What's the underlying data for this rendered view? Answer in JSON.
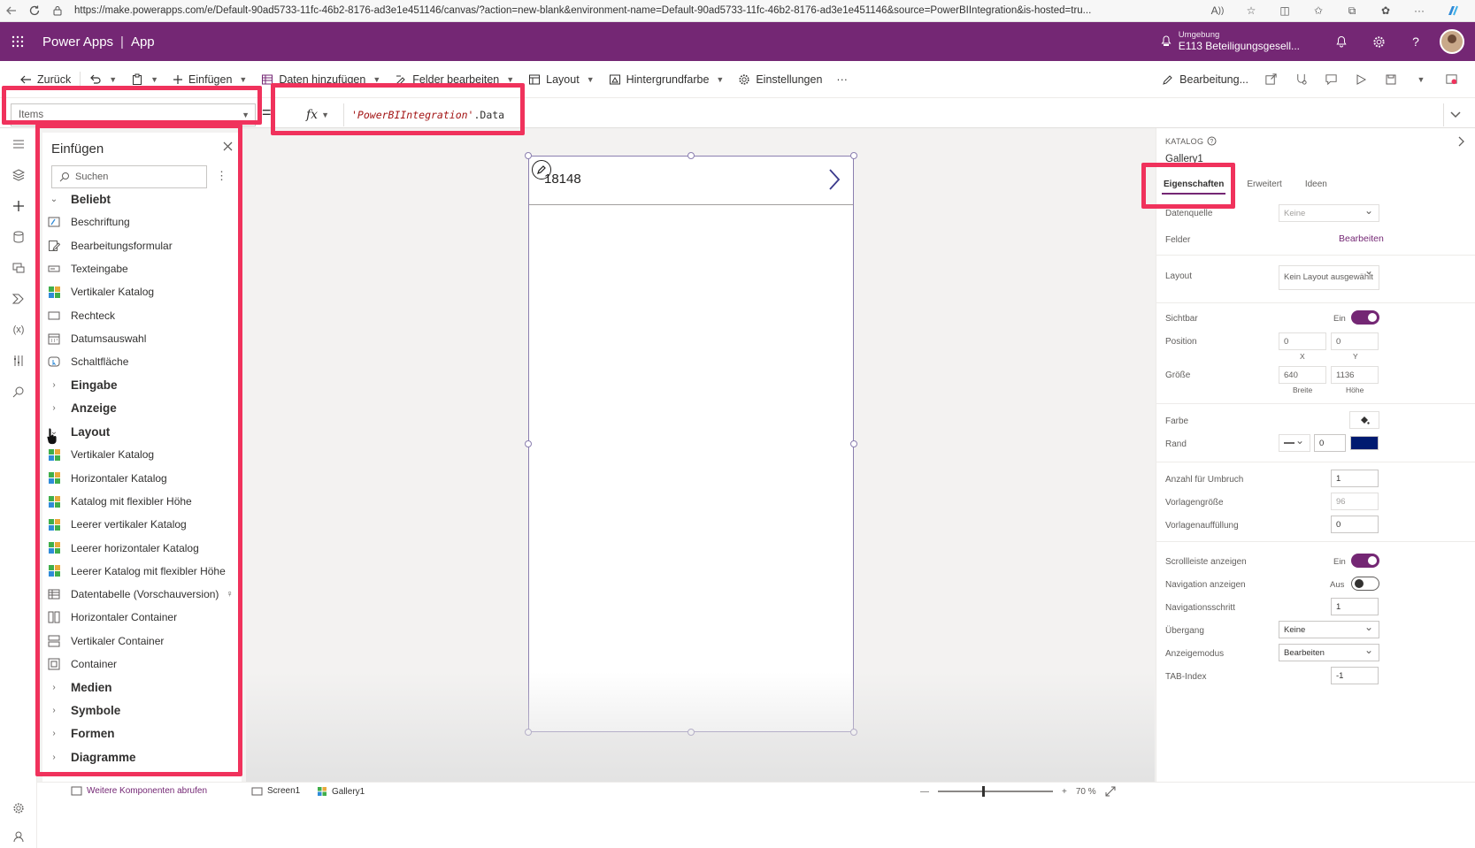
{
  "browser": {
    "url": "https://make.powerapps.com/e/Default-90ad5733-11fc-46b2-8176-ad3e1e451146/canvas/?action=new-blank&environment-name=Default-90ad5733-11fc-46b2-8176-ad3e1e451146&source=PowerBIIntegration&is-hosted=tru..."
  },
  "header": {
    "product": "Power Apps",
    "separator": "|",
    "app": "App",
    "env_label": "Umgebung",
    "env_name": "E113 Beteiligungsgesell..."
  },
  "commands": {
    "back": "Zurück",
    "insert": "Einfügen",
    "add_data": "Daten hinzufügen",
    "edit_fields": "Felder bearbeiten",
    "layout": "Layout",
    "background": "Hintergrundfarbe",
    "settings": "Einstellungen",
    "more": "···",
    "editing": "Bearbeitung..."
  },
  "formula": {
    "property": "Items",
    "equals": "=",
    "fx": "fx",
    "value_string": "'PowerBIIntegration'",
    "value_suffix": ".Data"
  },
  "insert_panel": {
    "title": "Einfügen",
    "search_placeholder": "Suchen",
    "items": [
      {
        "type": "category",
        "label": "Beliebt",
        "expanded": true
      },
      {
        "type": "item",
        "label": "Beschriftung",
        "icon": "label-icon"
      },
      {
        "type": "item",
        "label": "Bearbeitungsformular",
        "icon": "edit-form-icon"
      },
      {
        "type": "item",
        "label": "Texteingabe",
        "icon": "text-input-icon"
      },
      {
        "type": "item",
        "label": "Vertikaler Katalog",
        "icon": "gallery-icon"
      },
      {
        "type": "item",
        "label": "Rechteck",
        "icon": "rectangle-icon"
      },
      {
        "type": "item",
        "label": "Datumsauswahl",
        "icon": "calendar-icon"
      },
      {
        "type": "item",
        "label": "Schaltfläche",
        "icon": "button-icon"
      },
      {
        "type": "category",
        "label": "Eingabe",
        "expanded": false
      },
      {
        "type": "category",
        "label": "Anzeige",
        "expanded": false
      },
      {
        "type": "category",
        "label": "Layout",
        "expanded": true
      },
      {
        "type": "item",
        "label": "Vertikaler Katalog",
        "icon": "gallery-icon"
      },
      {
        "type": "item",
        "label": "Horizontaler Katalog",
        "icon": "gallery-icon"
      },
      {
        "type": "item",
        "label": "Katalog mit flexibler Höhe",
        "icon": "gallery-icon"
      },
      {
        "type": "item",
        "label": "Leerer vertikaler Katalog",
        "icon": "gallery-icon"
      },
      {
        "type": "item",
        "label": "Leerer horizontaler Katalog",
        "icon": "gallery-icon"
      },
      {
        "type": "item",
        "label": "Leerer Katalog mit flexibler Höhe",
        "icon": "gallery-icon"
      },
      {
        "type": "item",
        "label": "Datentabelle (Vorschauversion)",
        "icon": "table-icon",
        "extra": "lightbulb-icon"
      },
      {
        "type": "item",
        "label": "Horizontaler Container",
        "icon": "h-container-icon"
      },
      {
        "type": "item",
        "label": "Vertikaler Container",
        "icon": "v-container-icon"
      },
      {
        "type": "item",
        "label": "Container",
        "icon": "container-icon"
      },
      {
        "type": "category",
        "label": "Medien",
        "expanded": false
      },
      {
        "type": "category",
        "label": "Symbole",
        "expanded": false
      },
      {
        "type": "category",
        "label": "Formen",
        "expanded": false
      },
      {
        "type": "category",
        "label": "Diagramme",
        "expanded": false
      }
    ]
  },
  "canvas": {
    "gallery_item_title": "18148"
  },
  "properties": {
    "control_type": "KATALOG",
    "control_name": "Gallery1",
    "tabs": [
      "Eigenschaften",
      "Erweitert",
      "Ideen"
    ],
    "active_tab": "Eigenschaften",
    "data_source_label": "Datenquelle",
    "data_source_value": "Keine",
    "fields_label": "Felder",
    "fields_link": "Bearbeiten",
    "layout_label": "Layout",
    "layout_value": "Kein Layout ausgewählt",
    "visible_label": "Sichtbar",
    "visible_state": "Ein",
    "position_label": "Position",
    "pos_x": "0",
    "pos_y": "0",
    "pos_x_label": "X",
    "pos_y_label": "Y",
    "size_label": "Größe",
    "width": "640",
    "height": "1136",
    "width_label": "Breite",
    "height_label": "Höhe",
    "color_label": "Farbe",
    "border_label": "Rand",
    "border_width": "0",
    "border_color": "#001a70",
    "wrap_label": "Anzahl für Umbruch",
    "wrap_value": "1",
    "template_size_label": "Vorlagengröße",
    "template_size_value": "96",
    "template_padding_label": "Vorlagenauffüllung",
    "template_padding_value": "0",
    "scrollbar_label": "Scrollleiste anzeigen",
    "scrollbar_state": "Ein",
    "navigation_label": "Navigation anzeigen",
    "navigation_state": "Aus",
    "nav_step_label": "Navigationsschritt",
    "nav_step_value": "1",
    "transition_label": "Übergang",
    "transition_value": "Keine",
    "display_mode_label": "Anzeigemodus",
    "display_mode_value": "Bearbeiten",
    "tab_index_label": "TAB-Index",
    "tab_index_value": "-1"
  },
  "status": {
    "more_components": "Weitere Komponenten abrufen",
    "screen": "Screen1",
    "gallery": "Gallery1",
    "zoom_minus": "—",
    "zoom_plus": "+",
    "zoom_value": "70 %"
  },
  "colors": {
    "brand": "#742774",
    "highlight": "#f0325c"
  }
}
